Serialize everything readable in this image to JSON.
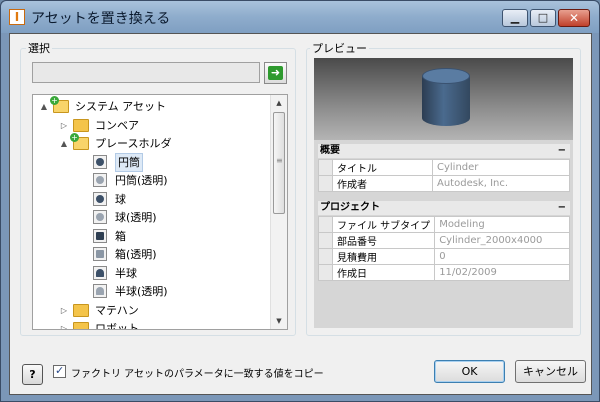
{
  "window": {
    "title": "アセットを置き換える",
    "app_icon_glyph": "I"
  },
  "left_panel": {
    "group_label": "選択",
    "search_value": "",
    "tree": [
      {
        "label": "システム アセット",
        "icon": "folder-open-add-icon",
        "twist": "▲",
        "depth": 0
      },
      {
        "label": "コンベア",
        "icon": "folder-icon",
        "twist": "▷",
        "depth": 1
      },
      {
        "label": "プレースホルダ",
        "icon": "folder-open-add-icon",
        "twist": "▲",
        "depth": 1
      },
      {
        "label": "円筒",
        "icon": "cylinder-icon",
        "twist": "",
        "depth": 2,
        "selected": true
      },
      {
        "label": "円筒(透明)",
        "icon": "cylinder-transparent-icon",
        "twist": "",
        "depth": 2
      },
      {
        "label": "球",
        "icon": "sphere-icon",
        "twist": "",
        "depth": 2
      },
      {
        "label": "球(透明)",
        "icon": "sphere-transparent-icon",
        "twist": "",
        "depth": 2
      },
      {
        "label": "箱",
        "icon": "box-icon",
        "twist": "",
        "depth": 2
      },
      {
        "label": "箱(透明)",
        "icon": "box-transparent-icon",
        "twist": "",
        "depth": 2
      },
      {
        "label": "半球",
        "icon": "hemisphere-icon",
        "twist": "",
        "depth": 2
      },
      {
        "label": "半球(透明)",
        "icon": "hemisphere-transparent-icon",
        "twist": "",
        "depth": 2
      },
      {
        "label": "マテハン",
        "icon": "folder-icon",
        "twist": "▷",
        "depth": 1
      },
      {
        "label": "ロボット",
        "icon": "folder-icon",
        "twist": "▷",
        "depth": 1
      }
    ]
  },
  "preview": {
    "group_label": "プレビュー",
    "sections": [
      {
        "title": "概要",
        "collapse_glyph": "−",
        "rows": [
          {
            "name": "タイトル",
            "value": "Cylinder"
          },
          {
            "name": "作成者",
            "value": "Autodesk, Inc."
          }
        ]
      },
      {
        "title": "プロジェクト",
        "collapse_glyph": "−",
        "rows": [
          {
            "name": "ファイル サブタイプ",
            "value": "Modeling"
          },
          {
            "name": "部品番号",
            "value": "Cylinder_2000x4000"
          },
          {
            "name": "見積費用",
            "value": "0"
          },
          {
            "name": "作成日",
            "value": "11/02/2009"
          }
        ]
      }
    ]
  },
  "footer": {
    "help_label": "?",
    "checkbox_label": "ファクトリ アセットのパラメータに一致する値をコピー",
    "checkbox_checked": true,
    "ok_label": "OK",
    "cancel_label": "キャンセル"
  },
  "colors": {
    "accent": "#3c7fb1",
    "selection": "#dde9f6",
    "titlebar": "#8eaccc"
  }
}
